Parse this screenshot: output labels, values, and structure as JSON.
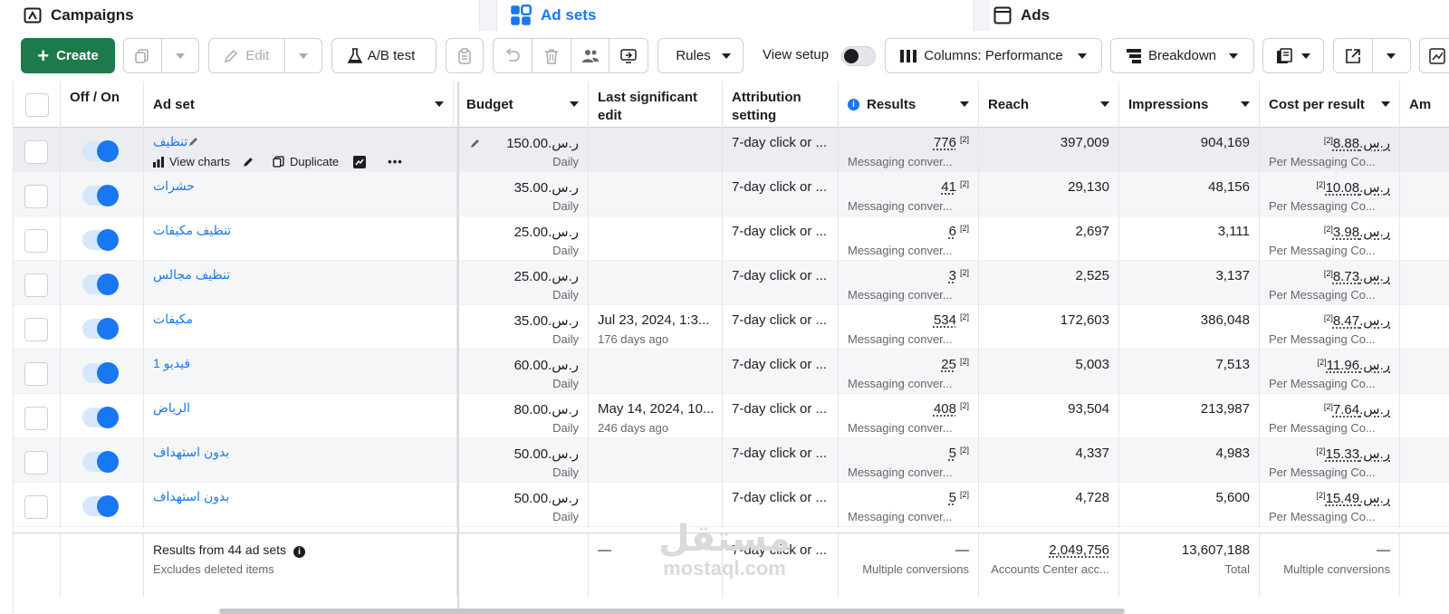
{
  "level_tabs": {
    "campaigns": "Campaigns",
    "adsets": "Ad sets",
    "ads": "Ads"
  },
  "toolbar": {
    "create": "Create",
    "edit": "Edit",
    "ab_test": "A/B test",
    "rules": "Rules",
    "view_setup": "View setup",
    "columns": "Columns: Performance",
    "breakdown": "Breakdown"
  },
  "columns": {
    "off_on": "Off / On",
    "ad_set": "Ad set",
    "budget": "Budget",
    "last_edit": "Last significant edit",
    "attribution": "Attribution setting",
    "results": "Results",
    "reach": "Reach",
    "impressions": "Impressions",
    "cost_per_result": "Cost per result",
    "amount_partial": "Am"
  },
  "row_actions": {
    "view_charts": "View charts",
    "duplicate": "Duplicate"
  },
  "rows": [
    {
      "name": "تنظيف",
      "budget": "ر.س.150.00",
      "budget_type": "Daily",
      "last_edit": "",
      "last_edit_ago": "",
      "attribution": "7-day click or ...",
      "results": "776",
      "results_type": "Messaging conver...",
      "reach": "397,009",
      "impressions": "904,169",
      "cost": "ر.س.8.88",
      "cost_type": "Per Messaging Co..."
    },
    {
      "name": "حشرات",
      "budget": "ر.س.35.00",
      "budget_type": "Daily",
      "last_edit": "",
      "last_edit_ago": "",
      "attribution": "7-day click or ...",
      "results": "41",
      "results_type": "Messaging conver...",
      "reach": "29,130",
      "impressions": "48,156",
      "cost": "ر.س.10.08",
      "cost_type": "Per Messaging Co..."
    },
    {
      "name": "تنظيف مكيفات",
      "budget": "ر.س.25.00",
      "budget_type": "Daily",
      "last_edit": "",
      "last_edit_ago": "",
      "attribution": "7-day click or ...",
      "results": "6",
      "results_type": "Messaging conver...",
      "reach": "2,697",
      "impressions": "3,111",
      "cost": "ر.س.3.98",
      "cost_type": "Per Messaging Co..."
    },
    {
      "name": "تنظيف مجالس",
      "budget": "ر.س.25.00",
      "budget_type": "Daily",
      "last_edit": "",
      "last_edit_ago": "",
      "attribution": "7-day click or ...",
      "results": "3",
      "results_type": "Messaging conver...",
      "reach": "2,525",
      "impressions": "3,137",
      "cost": "ر.س.8.73",
      "cost_type": "Per Messaging Co..."
    },
    {
      "name": "مكيفات",
      "budget": "ر.س.35.00",
      "budget_type": "Daily",
      "last_edit": "Jul 23, 2024, 1:3...",
      "last_edit_ago": "176 days ago",
      "attribution": "7-day click or ...",
      "results": "534",
      "results_type": "Messaging conver...",
      "reach": "172,603",
      "impressions": "386,048",
      "cost": "ر.س.8.47",
      "cost_type": "Per Messaging Co..."
    },
    {
      "name": "فيديو 1",
      "budget": "ر.س.60.00",
      "budget_type": "Daily",
      "last_edit": "",
      "last_edit_ago": "",
      "attribution": "7-day click or ...",
      "results": "25",
      "results_type": "Messaging conver...",
      "reach": "5,003",
      "impressions": "7,513",
      "cost": "ر.س.11.96",
      "cost_type": "Per Messaging Co..."
    },
    {
      "name": "الرياض",
      "budget": "ر.س.80.00",
      "budget_type": "Daily",
      "last_edit": "May 14, 2024, 10...",
      "last_edit_ago": "246 days ago",
      "attribution": "7-day click or ...",
      "results": "408",
      "results_type": "Messaging conver...",
      "reach": "93,504",
      "impressions": "213,987",
      "cost": "ر.س.7.64",
      "cost_type": "Per Messaging Co..."
    },
    {
      "name": "بدون استهداف",
      "budget": "ر.س.50.00",
      "budget_type": "Daily",
      "last_edit": "",
      "last_edit_ago": "",
      "attribution": "7-day click or ...",
      "results": "5",
      "results_type": "Messaging conver...",
      "reach": "4,337",
      "impressions": "4,983",
      "cost": "ر.س.15.33",
      "cost_type": "Per Messaging Co..."
    },
    {
      "name": "بدون استهداف",
      "budget": "ر.س.50.00",
      "budget_type": "Daily",
      "last_edit": "",
      "last_edit_ago": "",
      "attribution": "7-day click or ...",
      "results": "5",
      "results_type": "Messaging conver...",
      "reach": "4,728",
      "impressions": "5,600",
      "cost": "ر.س.15.49",
      "cost_type": "Per Messaging Co..."
    }
  ],
  "result_ref": "[2]",
  "footer": {
    "summary": "Results from 44 ad sets",
    "excludes": "Excludes deleted items",
    "last_edit": "—",
    "attribution": "7-day click or ...",
    "results": "—",
    "results_sub": "Multiple conversions",
    "reach": "2,049,756",
    "reach_sub": "Accounts Center acc...",
    "impressions": "13,607,188",
    "impressions_sub": "Total",
    "cost": "—",
    "cost_sub": "Multiple conversions"
  },
  "watermark": {
    "arabic": "مستقل",
    "latin": "mostaql.com"
  },
  "colors": {
    "accent": "#1877f2",
    "create": "#1d7a4a"
  }
}
